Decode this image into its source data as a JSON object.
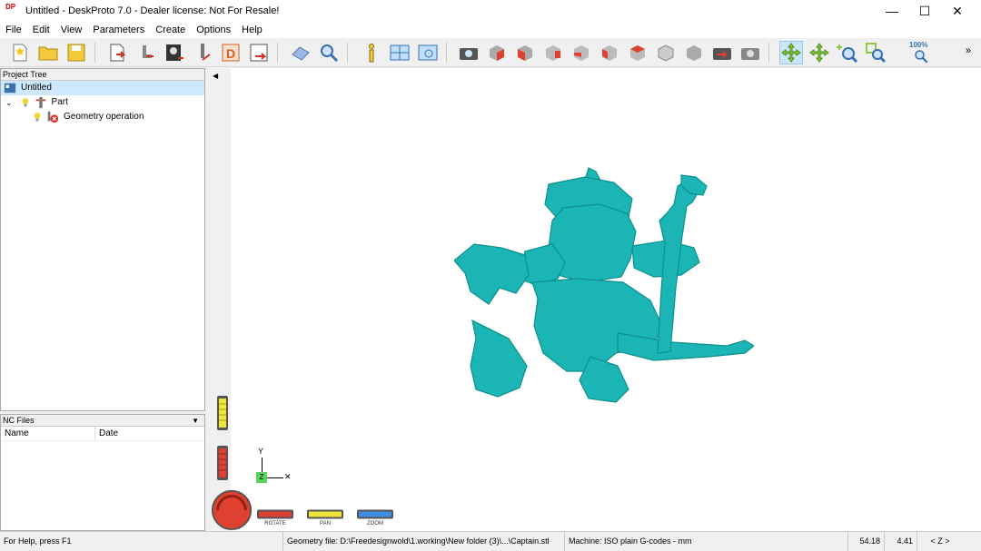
{
  "window": {
    "title": "Untitled - DeskProto 7.0 - Dealer license: Not For Resale!",
    "app_icon_text": "DP"
  },
  "menu": [
    "File",
    "Edit",
    "View",
    "Parameters",
    "Create",
    "Options",
    "Help"
  ],
  "toolbar": {
    "zoom_label": "100%"
  },
  "project_tree": {
    "header": "Project Tree",
    "root": "Untitled",
    "part": "Part",
    "operation": "Geometry operation"
  },
  "nc_files": {
    "header": "NC Files",
    "columns": [
      "Name",
      "Date"
    ]
  },
  "viewport": {
    "axis_y": "Y",
    "axis_z": "Z",
    "axis_x": "✕",
    "controls": {
      "rotate": "ROTATE",
      "pan": "PAN",
      "zoom": "ZOOM"
    },
    "model_color": "#1bb5b5"
  },
  "status": {
    "help": "For Help, press F1",
    "geometry": "Geometry file: D:\\Freedesignwold\\1.working\\New folder (3)\\...\\Captain.stl",
    "machine": "Machine: ISO plain G-codes - mm",
    "x": "54.18",
    "y": "4.41",
    "axis": "< Z >"
  }
}
